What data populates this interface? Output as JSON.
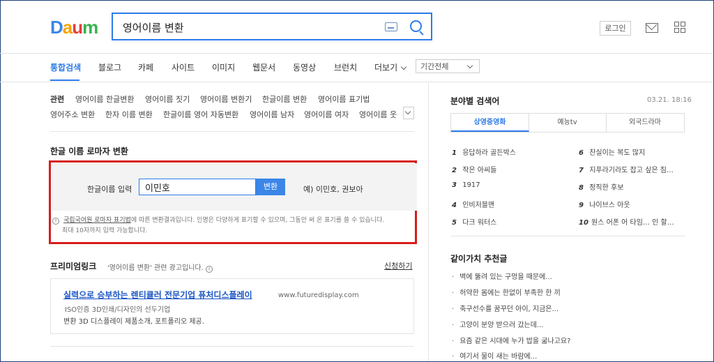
{
  "header": {
    "logo": [
      "D",
      "a",
      "u",
      "m"
    ],
    "logo_colors": [
      "#3b86e8",
      "#f4a300",
      "#e83b3b",
      "#37b24d"
    ],
    "search_value": "영어이름 변환",
    "login_label": "로그인"
  },
  "nav": {
    "tabs": [
      "통합검색",
      "블로그",
      "카페",
      "사이트",
      "이미지",
      "웹문서",
      "동영상",
      "브런치",
      "더보기"
    ],
    "period": "기간전체"
  },
  "related": {
    "label": "관련",
    "items": [
      "영어이름 한글변환",
      "영어이름 짓기",
      "영어이름 변환기",
      "한글이름 변환",
      "영어이름 표기법",
      "영어주소 변환",
      "한자 이름 변환",
      "한글이름 영어 자동변환",
      "영어이름 남자",
      "영어이름 여자",
      "영어이름 웃"
    ]
  },
  "converter": {
    "title": "한글 이름 로마자 변환",
    "label": "한글이름 입력",
    "value": "이민호",
    "button": "변환",
    "example": "예) 이민호, 권보아",
    "notice_link": "국립국어원 로마자 표기법",
    "notice_text": "에 따른 변환결과입니다. 인명은 다양하게 표기할 수 있으며, 그동안 써 온 표기를 쓸 수 있습니다.",
    "notice_line2": "최대 10자까지 입력 가능합니다."
  },
  "premium": {
    "title": "프리미엄링크",
    "subtitle": "'영어이름 변환' 관련 광고입니다.",
    "apply": "신청하기",
    "ad_title": "실력으로 승부하는 렌티큘러 전문기업 퓨처디스플레이",
    "ad_url": "www.futuredisplay.com",
    "ad_desc1": "ISO인증 3D인쇄/디자인의 선두기업",
    "ad_desc2": "변환 3D 디스플레이 제품소개, 포트폴리오 제공."
  },
  "right_panel": {
    "title": "분야별 검색어",
    "time": "03.21. 18:16",
    "tabs": [
      "상영중영화",
      "예능tv",
      "외국드라마"
    ],
    "ranks": [
      {
        "n": "1",
        "t": "응답하라 골든박스"
      },
      {
        "n": "2",
        "t": "작은 아씨들"
      },
      {
        "n": "3",
        "t": "1917"
      },
      {
        "n": "4",
        "t": "인비저블맨"
      },
      {
        "n": "5",
        "t": "다크 워터스"
      },
      {
        "n": "6",
        "t": "찬실이는 복도 많지"
      },
      {
        "n": "7",
        "t": "지푸라기라도 잡고 싶은 짐…"
      },
      {
        "n": "8",
        "t": "정직한 후보"
      },
      {
        "n": "9",
        "t": "나이브스 아웃"
      },
      {
        "n": "10",
        "t": "원스 어폰 어 타임… 인 할…"
      }
    ],
    "rec_title": "같이가치 추천글",
    "recs": [
      "벽에 뚫려 있는 구멍을 때문에...",
      "허약한 몸에는 한없이 부족한 한 끼",
      "축구선수를 꿈꾸던 아이, 지금은...",
      "고양이 분양 받으러 갔는데...",
      "요즘 같은 시대에 누가 밥을 굶나고요?",
      "여기서 물이 새는 바람에..."
    ]
  }
}
